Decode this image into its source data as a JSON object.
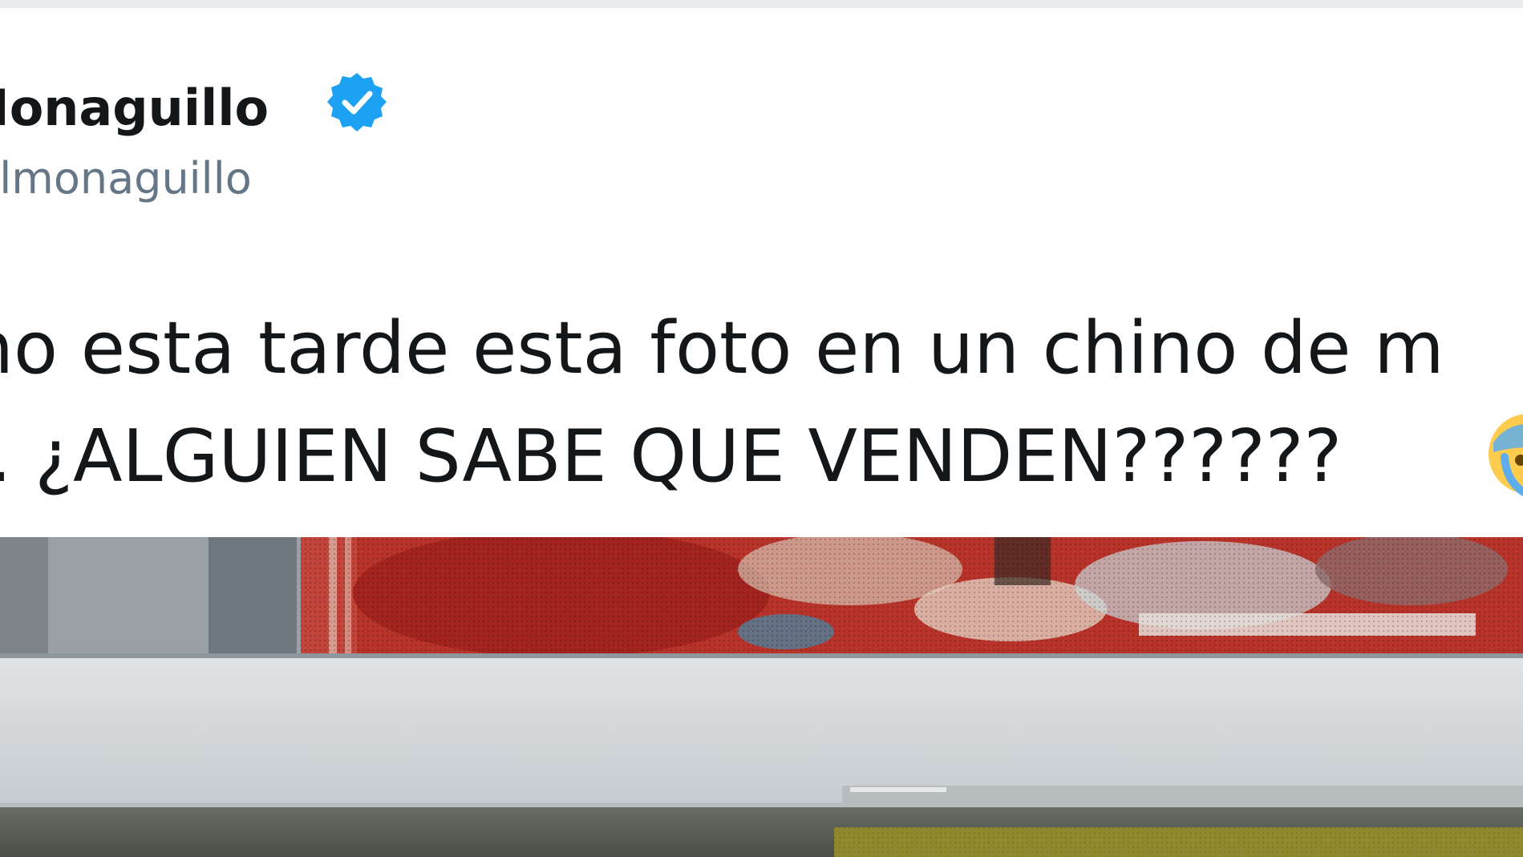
{
  "tweet": {
    "display_name": "Monaguillo",
    "handle": "elmonaguillo",
    "verified_icon": "verified-badge-icon",
    "text_line_1": "ho esta tarde esta foto en un chino de m",
    "text_line_2": ". ¿ALGUIEN SABE QUE VENDEN??????",
    "emoji_icon": "anxious-face-with-sweat-emoji",
    "photo_icon": "attached-photo"
  },
  "colors": {
    "name": "#14171a",
    "handle": "#657786",
    "verified": "#1da1f2",
    "background": "#ffffff"
  }
}
